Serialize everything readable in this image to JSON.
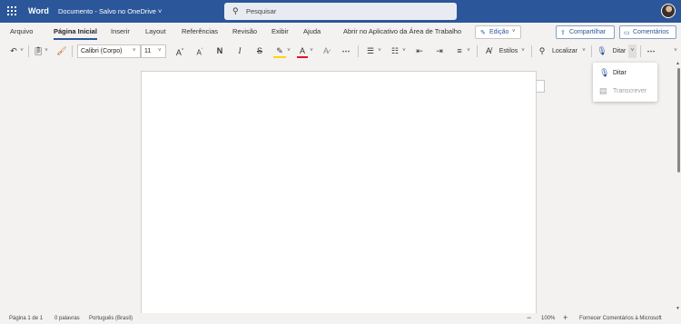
{
  "titlebar": {
    "app_name": "Word",
    "document_title": "Documento - Salvo no OneDrive ˅",
    "search_placeholder": "Pesquisar",
    "brand_color": "#2b579a"
  },
  "menubar": {
    "tabs": [
      "Arquivo",
      "Página Inicial",
      "Inserir",
      "Layout",
      "Referências",
      "Revisão",
      "Exibir",
      "Ajuda",
      "Abrir no Aplicativo da Área de Trabalho"
    ],
    "active_tab": "Página Inicial",
    "edit_mode_label": "Edição",
    "share_label": "Compartilhar",
    "comments_label": "Comentários"
  },
  "ribbon": {
    "font_name": "Calibri (Corpo)",
    "font_size": "11",
    "styles_label": "Estilos",
    "find_label": "Localizar",
    "dictate_label": "Ditar",
    "more_label": "⋯"
  },
  "dropdown": {
    "items": [
      {
        "label": "Ditar",
        "icon": "microphone-icon",
        "enabled": true
      },
      {
        "label": "Transcrever",
        "icon": "transcribe-icon",
        "enabled": false
      }
    ]
  },
  "statusbar": {
    "page": "Página 1 de 1",
    "words": "0 palavras",
    "language": "Português (Brasil)",
    "zoom": "100%",
    "feedback": "Fornecer Comentários à Microsoft"
  }
}
